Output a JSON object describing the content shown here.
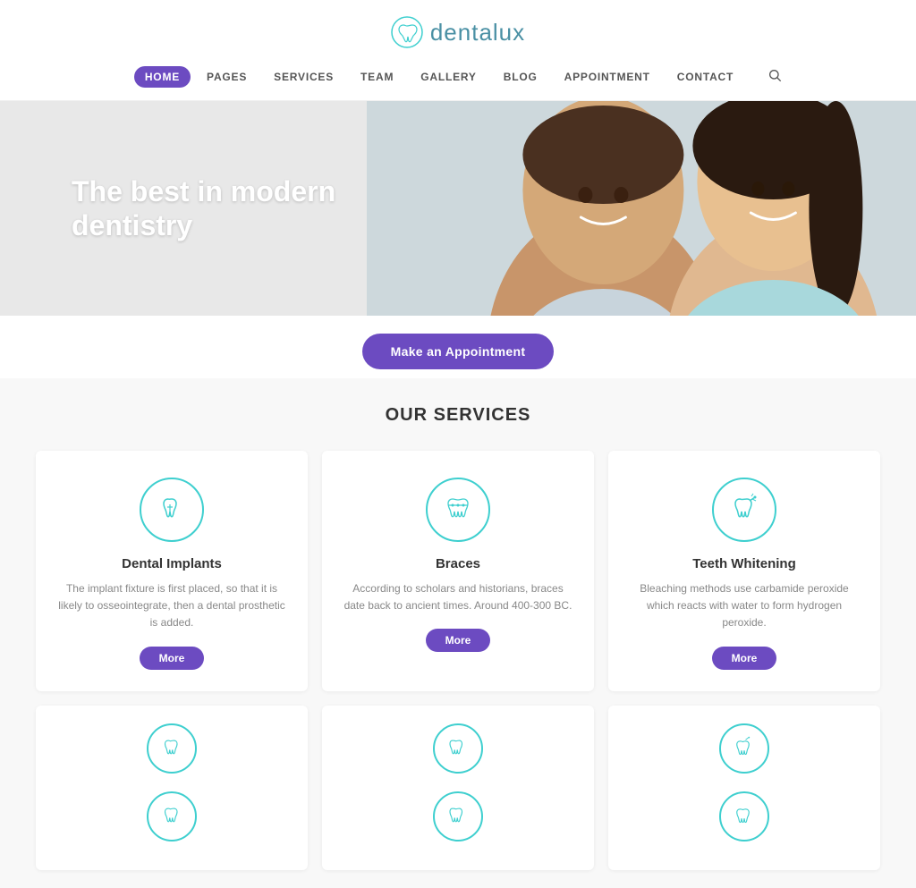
{
  "site": {
    "logo_text": "dentalux",
    "tagline": "The best in modern dentistry",
    "appointment_btn": "Make an Appointment"
  },
  "nav": {
    "items": [
      {
        "label": "HOME",
        "active": true
      },
      {
        "label": "PAGES",
        "active": false
      },
      {
        "label": "SERVICES",
        "active": false
      },
      {
        "label": "TEAM",
        "active": false
      },
      {
        "label": "GALLERY",
        "active": false
      },
      {
        "label": "BLOG",
        "active": false
      },
      {
        "label": "APPOINTMENT",
        "active": false
      },
      {
        "label": "CONTACT",
        "active": false
      }
    ]
  },
  "services_section": {
    "title": "OUR SERVICES",
    "cards": [
      {
        "name": "Dental Implants",
        "desc": "The implant fixture is first placed, so that it is likely to osseointegrate, then a dental prosthetic is added.",
        "btn": "More"
      },
      {
        "name": "Braces",
        "desc": "According to scholars and historians, braces date back to ancient times. Around 400-300 BC.",
        "btn": "More"
      },
      {
        "name": "Teeth Whitening",
        "desc": "Bleaching methods use carbamide peroxide which reacts with water to form hydrogen peroxide.",
        "btn": "More"
      }
    ]
  },
  "colors": {
    "primary": "#6c4bc1",
    "accent": "#3ecfcf",
    "hero_bg": "#e0e0e0"
  }
}
